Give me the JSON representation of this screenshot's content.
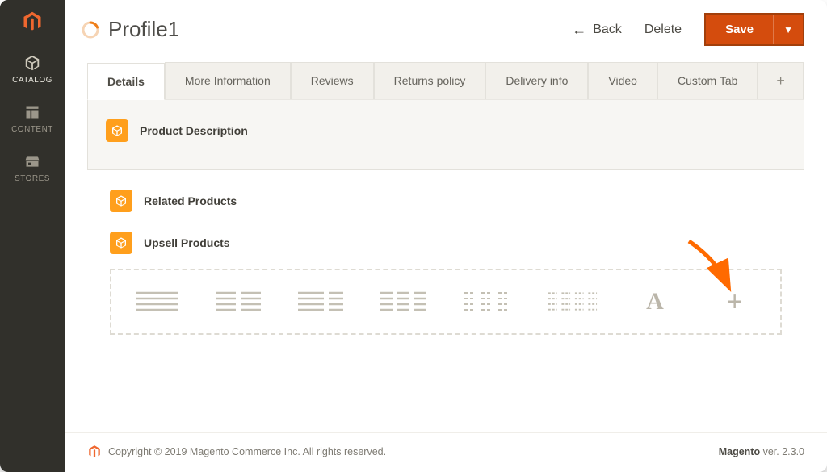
{
  "sidebar": {
    "items": [
      {
        "label": "CATALOG"
      },
      {
        "label": "CONTENT"
      },
      {
        "label": "STORES"
      }
    ]
  },
  "header": {
    "title": "Profile1",
    "back": "Back",
    "delete": "Delete",
    "save": "Save"
  },
  "tabs": [
    {
      "label": "Details",
      "active": true
    },
    {
      "label": "More Information"
    },
    {
      "label": "Reviews"
    },
    {
      "label": "Returns policy"
    },
    {
      "label": "Delivery info"
    },
    {
      "label": "Video"
    },
    {
      "label": "Custom Tab"
    }
  ],
  "panel": {
    "title": "Product Description"
  },
  "sections": [
    {
      "title": "Related Products"
    },
    {
      "title": "Upsell Products"
    }
  ],
  "layout_options": [
    {
      "name": "layout-1col"
    },
    {
      "name": "layout-2col"
    },
    {
      "name": "layout-2col-sidebar"
    },
    {
      "name": "layout-3col"
    },
    {
      "name": "layout-3col-narrow"
    },
    {
      "name": "layout-4col"
    },
    {
      "name": "text-block"
    },
    {
      "name": "add-block"
    }
  ],
  "footer": {
    "copyright": "Copyright © 2019 Magento Commerce Inc. All rights reserved.",
    "brand": "Magento",
    "version_prefix": " ver. ",
    "version": "2.3.0"
  },
  "colors": {
    "accent": "#ff9f1c",
    "primary_btn": "#d44c0d"
  }
}
